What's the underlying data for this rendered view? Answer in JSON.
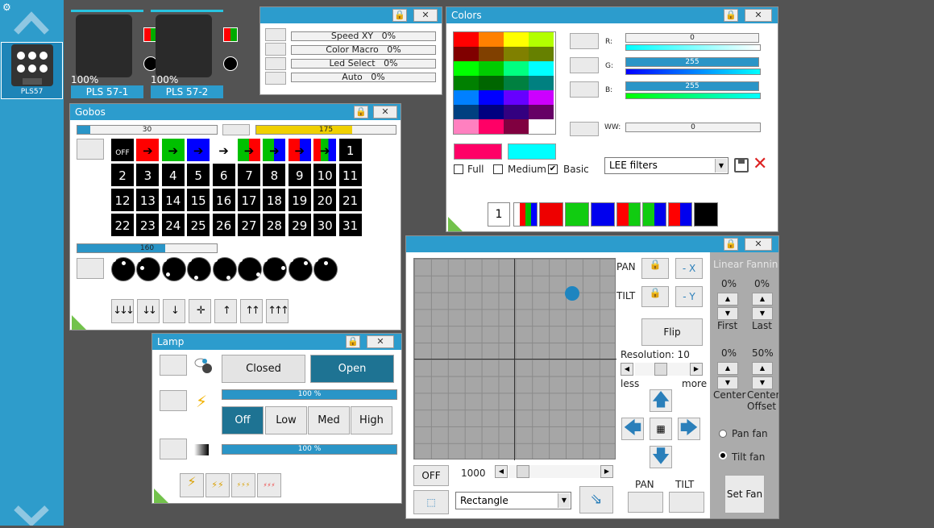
{
  "sidebar": {
    "fixture_label": "PLS57",
    "settings_icon": "gear-icon",
    "up_icon": "chevron-up-icon",
    "down_icon": "chevron-down-icon"
  },
  "fixtures": [
    {
      "name": "PLS 57-1",
      "intensity": "100%"
    },
    {
      "name": "PLS 57-2",
      "intensity": "100%"
    }
  ],
  "channels": {
    "items": [
      {
        "name": "Speed XY",
        "value": "0%"
      },
      {
        "name": "Color Macro",
        "value": "0%"
      },
      {
        "name": "Led Select",
        "value": "0%"
      },
      {
        "name": "Auto",
        "value": "0%"
      }
    ]
  },
  "gobos": {
    "title": "Gobos",
    "bar1": "30",
    "bar1_frac": 0.09,
    "bar2": "175",
    "bar2_frac": 0.69,
    "bar3": "160",
    "bar3_frac": 0.63,
    "row1": [
      "OFF",
      "",
      "",
      "",
      "",
      "",
      "",
      "",
      "",
      "1"
    ],
    "grid": [
      [
        "2",
        "3",
        "4",
        "5",
        "6",
        "7",
        "8",
        "9",
        "10",
        "11"
      ],
      [
        "12",
        "13",
        "14",
        "15",
        "16",
        "17",
        "18",
        "19",
        "20",
        "21"
      ],
      [
        "22",
        "23",
        "24",
        "25",
        "26",
        "27",
        "28",
        "29",
        "30",
        "31"
      ]
    ],
    "move_buttons": [
      "↓↓↓",
      "↓↓",
      "↓",
      "✛",
      "↑",
      "↑↑",
      "↑↑↑"
    ]
  },
  "colors": {
    "title": "Colors",
    "r_label": "R:",
    "g_label": "G:",
    "b_label": "B:",
    "ww_label": "WW:",
    "r": "0",
    "g": "255",
    "b": "255",
    "ww": "0",
    "palette": [
      "#ff0000",
      "#ff8000",
      "#ffff00",
      "#b3ff00",
      "#800000",
      "#804000",
      "#808000",
      "#668000",
      "#00ff00",
      "#00cc00",
      "#00ff80",
      "#00ffff",
      "#008000",
      "#006600",
      "#008040",
      "#008080",
      "#0080ff",
      "#0000ff",
      "#6600ff",
      "#cc00ff",
      "#004080",
      "#000080",
      "#330080",
      "#660066",
      "#ff80c0",
      "#ff0066",
      "#800040",
      "#ffffff"
    ],
    "color_a": "#ff0066",
    "color_b": "#00ffff",
    "full_label": "Full",
    "medium_label": "Medium",
    "basic_label": "Basic",
    "filter_select": "LEE filters",
    "preset_number": "1"
  },
  "lamp": {
    "title": "Lamp",
    "closed_label": "Closed",
    "open_label": "Open",
    "bar1": "100 %",
    "bar2": "100 %",
    "modes": [
      "Off",
      "Low",
      "Med",
      "High"
    ]
  },
  "position": {
    "pan_label": "PAN",
    "tilt_label": "TILT",
    "minus_x": "- X",
    "minus_y": "- Y",
    "flip_label": "Flip",
    "resolution_label": "Resolution: 10",
    "less_label": "less",
    "more_label": "more",
    "off_label": "OFF",
    "speed_value": "1000",
    "shape_select": "Rectangle",
    "pan_btn_label": "PAN",
    "tilt_btn_label": "TILT",
    "dot_x": 0.78,
    "dot_y": 0.17
  },
  "fanning": {
    "title": "Linear Fanning",
    "first_value": "0%",
    "last_value": "0%",
    "first_label": "First",
    "last_label": "Last",
    "center_value": "0%",
    "offset_value": "50%",
    "center_label": "Center",
    "offset_label": "Center\nOffset",
    "pan_fan": "Pan fan",
    "tilt_fan": "Tilt fan",
    "set_fan": "Set Fan"
  }
}
